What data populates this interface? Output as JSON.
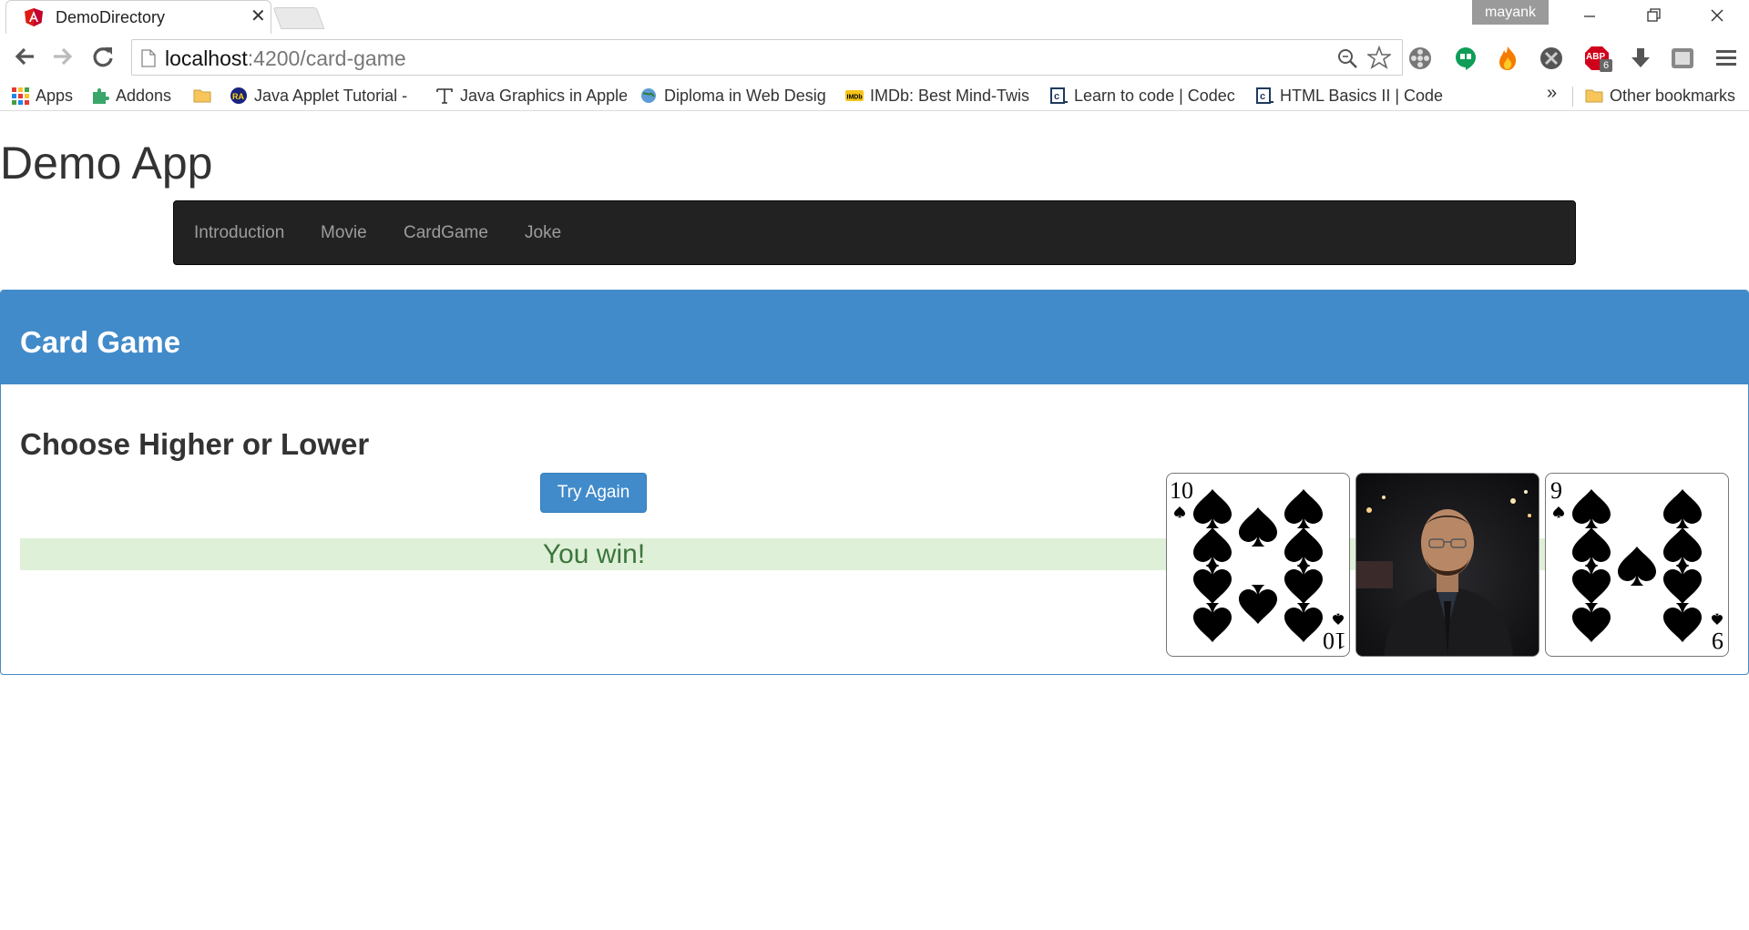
{
  "browser": {
    "tab_title": "DemoDirectory",
    "tab_close": "✕",
    "profile_name": "mayank",
    "url_host": "localhost",
    "url_path": ":4200/card-game",
    "bookmarks": [
      {
        "label": "Apps",
        "icon": "apps-grid-icon"
      },
      {
        "label": "Addons",
        "icon": "puzzle-icon"
      },
      {
        "label": "",
        "icon": "folder-icon"
      },
      {
        "label": "Java Applet Tutorial -",
        "icon": "ra-logo-icon"
      },
      {
        "label": "Java Graphics in Apple",
        "icon": "typewriter-t-icon"
      },
      {
        "label": "Diploma in Web Desig",
        "icon": "globe-icon"
      },
      {
        "label": "IMDb: Best Mind-Twis",
        "icon": "imdb-icon"
      },
      {
        "label": "Learn to code | Codec",
        "icon": "codecademy-icon"
      },
      {
        "label": "HTML Basics II | Code",
        "icon": "codecademy-icon"
      }
    ],
    "bookmarks_overflow": "»",
    "other_bookmarks": "Other bookmarks",
    "extension_badge": "6",
    "abp_label": "ABP"
  },
  "page": {
    "app_title": "Demo App",
    "nav": [
      "Introduction",
      "Movie",
      "CardGame",
      "Joke"
    ],
    "panel_title": "Card Game",
    "heading": "Choose Higher or Lower",
    "button": "Try Again",
    "result": "You win!",
    "cards": [
      {
        "rank": "10",
        "suit": "spades"
      },
      {
        "rank": "",
        "suit": "",
        "kind": "photo"
      },
      {
        "rank": "9",
        "suit": "spades"
      }
    ]
  },
  "colors": {
    "primary": "#428bca",
    "navbar": "#222222",
    "nav_link": "#9d9d9d",
    "success_bg": "#dff0d8",
    "success_text": "#3c763d"
  }
}
